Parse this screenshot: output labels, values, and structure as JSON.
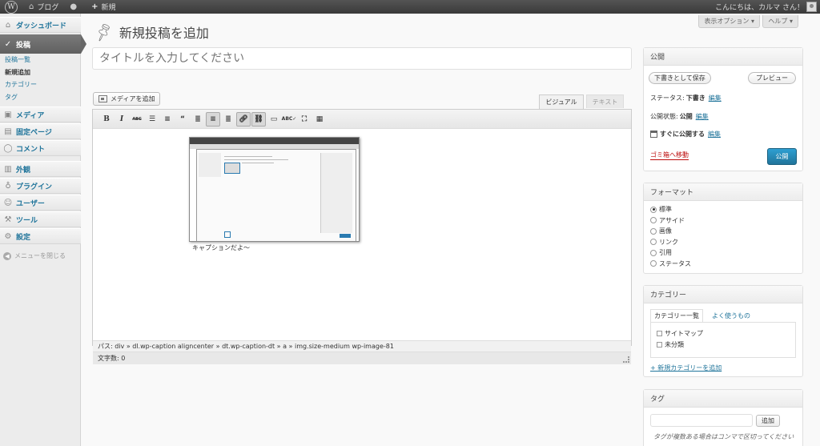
{
  "adminbar": {
    "wp_logo": "W",
    "site_name": "ブログ",
    "new_label": "新規",
    "greeting": "こんにちは、カルマ さん！"
  },
  "sidebar": {
    "items": [
      {
        "label": "ダッシュボード",
        "icon": "dashboard-icon"
      },
      {
        "label": "投稿",
        "icon": "pin-icon"
      },
      {
        "label": "メディア",
        "icon": "media-icon"
      },
      {
        "label": "固定ページ",
        "icon": "page-icon"
      },
      {
        "label": "コメント",
        "icon": "comment-icon"
      },
      {
        "label": "外観",
        "icon": "appearance-icon"
      },
      {
        "label": "プラグイン",
        "icon": "plugin-icon"
      },
      {
        "label": "ユーザー",
        "icon": "users-icon"
      },
      {
        "label": "ツール",
        "icon": "tools-icon"
      },
      {
        "label": "設定",
        "icon": "settings-icon"
      }
    ],
    "submenu": [
      "投稿一覧",
      "新規追加",
      "カテゴリー",
      "タグ"
    ],
    "collapse": "メニューを閉じる"
  },
  "header": {
    "screen_options": "表示オプション ▾",
    "help": "ヘルプ ▾",
    "title": "新規投稿を追加"
  },
  "editor": {
    "title_placeholder": "タイトルを入力してください",
    "add_media": "メディアを追加",
    "tab_visual": "ビジュアル",
    "tab_text": "テキスト",
    "caption": "キャプションだよ〜",
    "path": "パス: div » dl.wp-caption aligncenter » dt.wp-caption-dt » a » img.size-medium wp-image-81",
    "word_count": "文字数: 0"
  },
  "publish": {
    "title": "公開",
    "save_draft": "下書きとして保存",
    "preview": "プレビュー",
    "status_label": "ステータス:",
    "status_value": "下書き",
    "visibility_label": "公開状態:",
    "visibility_value": "公開",
    "schedule_label": "すぐに公開する",
    "edit": "編集",
    "trash": "ゴミ箱へ移動",
    "publish": "公開"
  },
  "format": {
    "title": "フォーマット",
    "options": [
      "標準",
      "アサイド",
      "画像",
      "リンク",
      "引用",
      "ステータス"
    ],
    "selected": 0
  },
  "category": {
    "title": "カテゴリー",
    "tab_all": "カテゴリー一覧",
    "tab_popular": "よく使うもの",
    "items": [
      "サイトマップ",
      "未分類"
    ],
    "add_new": "+ 新規カテゴリーを追加"
  },
  "tags": {
    "title": "タグ",
    "add": "追加",
    "help": "タグが複数ある場合はコンマで区切ってください"
  }
}
